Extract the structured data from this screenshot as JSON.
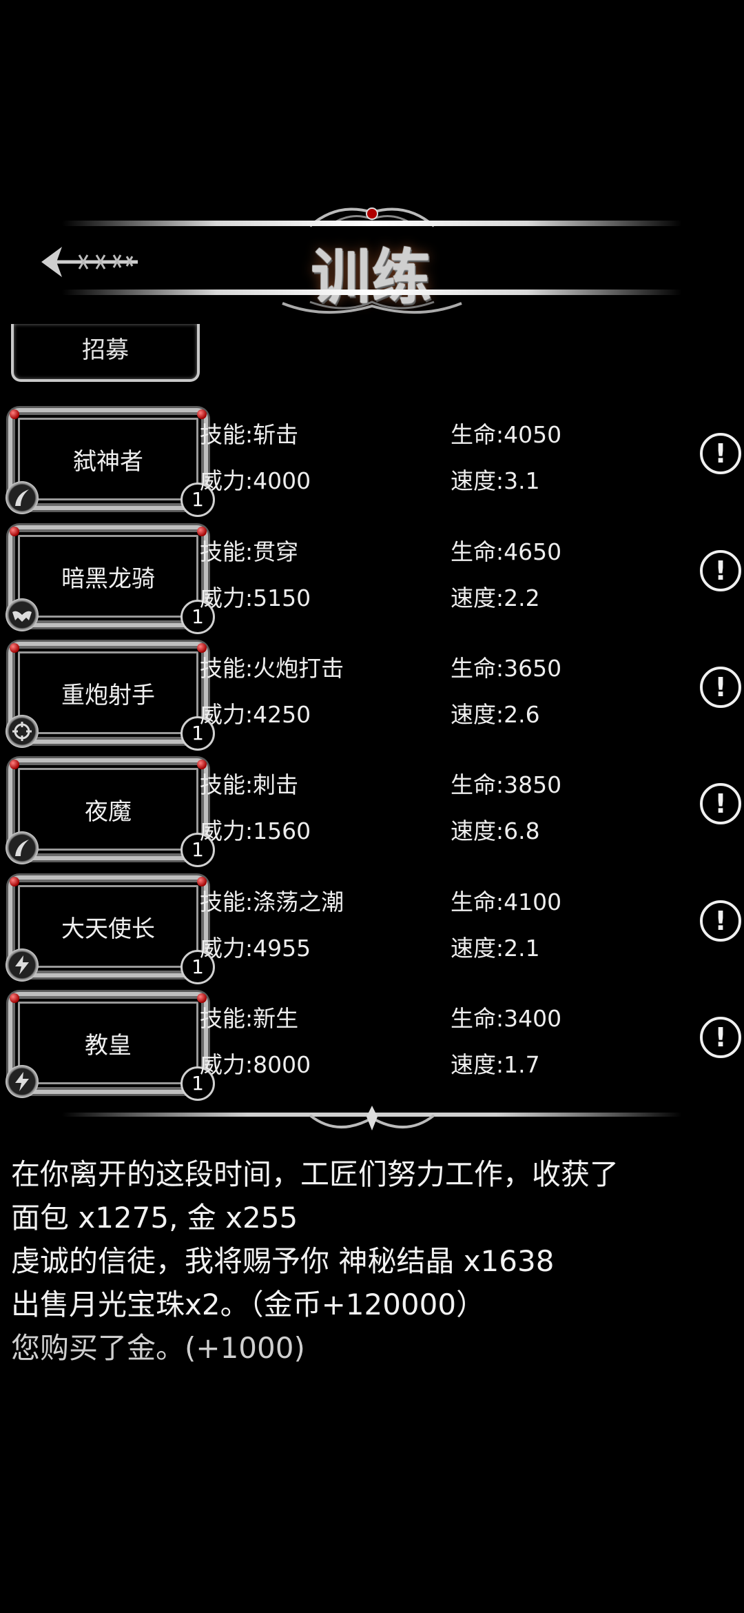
{
  "header": {
    "title": "训练"
  },
  "tab": {
    "recruit_label": "招募"
  },
  "heroes": [
    {
      "name": "弑神者",
      "skill": "技能:斩击",
      "power": "威力:4000",
      "hp": "生命:4050",
      "speed": "速度:3.1",
      "level": "1",
      "class_icon": "blade-icon"
    },
    {
      "name": "暗黑龙骑",
      "skill": "技能:贯穿",
      "power": "威力:5150",
      "hp": "生命:4650",
      "speed": "速度:2.2",
      "level": "1",
      "class_icon": "bat-wings-icon"
    },
    {
      "name": "重炮射手",
      "skill": "技能:火炮打击",
      "power": "威力:4250",
      "hp": "生命:3650",
      "speed": "速度:2.6",
      "level": "1",
      "class_icon": "crosshair-icon"
    },
    {
      "name": "夜魔",
      "skill": "技能:刺击",
      "power": "威力:1560",
      "hp": "生命:3850",
      "speed": "速度:6.8",
      "level": "1",
      "class_icon": "blade-icon"
    },
    {
      "name": "大天使长",
      "skill": "技能:涤荡之潮",
      "power": "威力:4955",
      "hp": "生命:4100",
      "speed": "速度:2.1",
      "level": "1",
      "class_icon": "lightning-icon"
    },
    {
      "name": "教皇",
      "skill": "技能:新生",
      "power": "威力:8000",
      "hp": "生命:3400",
      "speed": "速度:1.7",
      "level": "1",
      "class_icon": "lightning-icon"
    }
  ],
  "info_symbol": "!",
  "log": [
    "在你离开的这段时间，工匠们努力工作，收获了",
    "面包 x1275, 金 x255",
    "虔诚的信徒，我将赐予你 神秘结晶 x1638",
    "出售月光宝珠x2。（金币+120000）",
    "您购买了金。(+1000)"
  ],
  "colors": {
    "background": "#000000",
    "text": "#eeeeee",
    "frame": "#bfbfbf",
    "gem": "#c00000"
  }
}
